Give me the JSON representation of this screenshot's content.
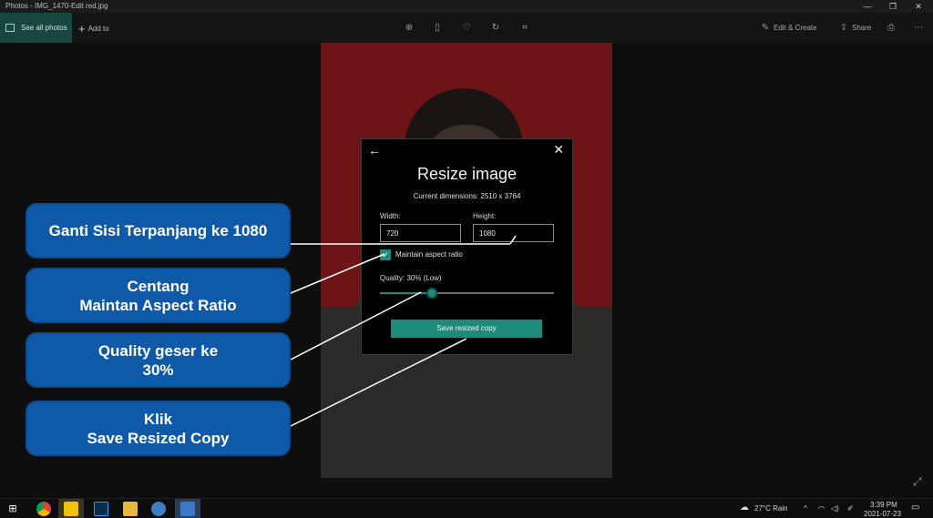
{
  "window": {
    "title": "Photos - IMG_1470-Edit red.jpg",
    "controls": {
      "minimize": "—",
      "maximize": "❐",
      "close": "✕"
    }
  },
  "toolbar": {
    "see_all_photos": "See all photos",
    "add_to": "Add to",
    "add_to_icon": "+",
    "edit_create": "Edit & Create",
    "share": "Share",
    "icons": [
      "zoom-in-icon",
      "delete-icon",
      "favorite-icon",
      "rotate-icon",
      "crop-icon",
      "print-icon",
      "more-icon"
    ]
  },
  "dialog": {
    "title": "Resize image",
    "current_dimensions": "Current dimensions: 2510 x 3764",
    "width_label": "Width:",
    "width_value": "720",
    "height_label": "Height:",
    "height_value": "1080",
    "maintain_aspect_label": "Maintain aspect ratio",
    "maintain_aspect_checked": true,
    "quality_label": "Quality: 30% (Low)",
    "quality_value": 0.3,
    "save_button": "Save resized copy",
    "back_glyph": "←",
    "close_glyph": "✕",
    "accent_color": "#1e8a7c"
  },
  "callouts": [
    {
      "lines": [
        "Ganti Sisi Terpanjang ke 1080"
      ]
    },
    {
      "lines": [
        "Centang",
        "Maintan Aspect Ratio"
      ]
    },
    {
      "lines": [
        "Quality geser ke",
        "30%"
      ]
    },
    {
      "lines": [
        "Klik",
        "Save Resized Copy"
      ]
    }
  ],
  "taskbar": {
    "weather": "27°C  Rain",
    "time": "3:39 PM",
    "date": "2021-07-23"
  }
}
